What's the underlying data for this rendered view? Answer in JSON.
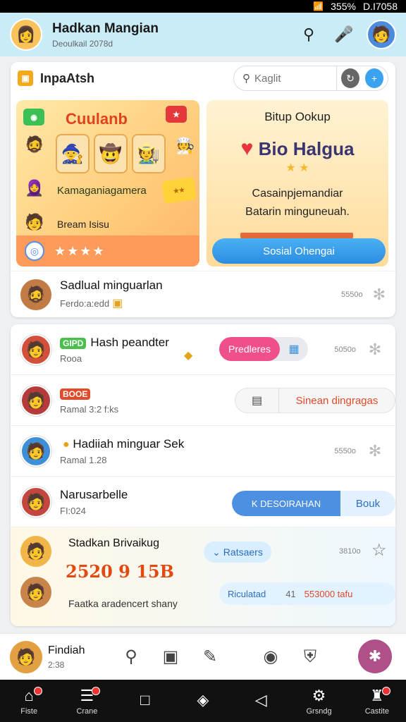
{
  "status": {
    "time": "D.I7058",
    "battery": "355%"
  },
  "header": {
    "title": "Hadkan Mangian",
    "subtitle": "Deoulkail 2078d"
  },
  "card": {
    "brand": "InpaAtsh",
    "search_placeholder": "Kaglit",
    "promo_left": {
      "title": "Cuulanb",
      "line1": "Kamaganiagamera",
      "line2": "Bream Isisu"
    },
    "promo_right": {
      "title": "Bitup Ookup",
      "big": "Bio Halgua",
      "desc1": "Casainpjemandiar",
      "desc2": "Batarin minguneuah.",
      "cta": "Sosial Ohengai"
    },
    "row_a": {
      "name": "Sadlual minguarlan",
      "sub": "Ferdo:a:edd",
      "time": "5550o"
    }
  },
  "list": [
    {
      "name": "Hash peandter",
      "badge": "GIPD",
      "sub": "Rooa",
      "button": "Predleres",
      "time": "5050o"
    },
    {
      "name": "",
      "badge": "BOOE",
      "sub": "Ramal 3:2 f:ks",
      "button": "Sinean dingragas"
    },
    {
      "name": "Hadiiah minguar Sek",
      "sub": "Ramal 1.28",
      "time": "5550o"
    },
    {
      "name": "Narusarbelle",
      "sub": "FI:024",
      "button": "K DESOIRAHAN",
      "button2": "Bouk"
    }
  ],
  "tall_row": {
    "name": "Stadkan Brivaikug",
    "big": "2520 9 15B",
    "caption": "Faatka aradencert shany",
    "chip": "Ratsaers",
    "time": "3810o",
    "pill_a": "Riculatad",
    "pill_b": "41",
    "pill_c": "553000 tafu"
  },
  "dock": {
    "name": "Findiah",
    "sub": "2:38"
  },
  "navbar": [
    {
      "label": "Fiste"
    },
    {
      "label": "Crane"
    },
    {
      "label": ""
    },
    {
      "label": ""
    },
    {
      "label": ""
    },
    {
      "label": "Grsndg"
    },
    {
      "label": "Castite"
    }
  ]
}
